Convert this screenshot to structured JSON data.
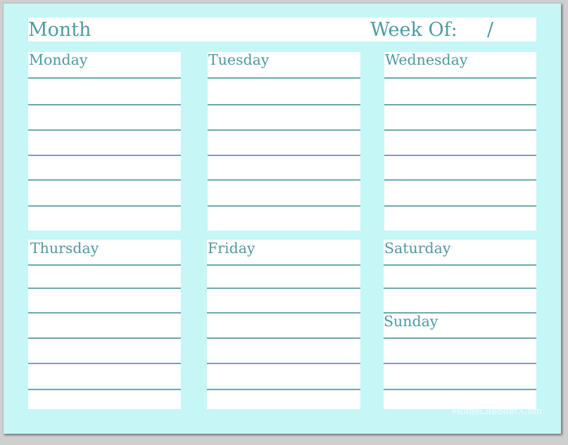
{
  "header": {
    "month_label": "Month",
    "week_of_label": "Week Of:",
    "date_separator": "/"
  },
  "days": [
    {
      "name": "Monday"
    },
    {
      "name": "Tuesday"
    },
    {
      "name": "Wednesday"
    },
    {
      "name": "Thursday"
    },
    {
      "name": "Friday"
    },
    {
      "name": "Saturday"
    },
    {
      "name": "Sunday"
    }
  ],
  "watermark": "MomsLifeboat.Com",
  "colors": {
    "background": "#c6f6f6",
    "text": "#4e9aa3",
    "rule": "#6ea8ac",
    "box": "#ffffff"
  }
}
